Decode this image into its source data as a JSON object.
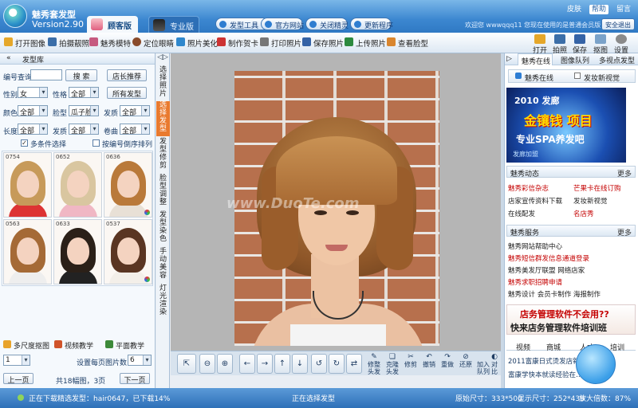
{
  "app": {
    "name": "魅秀套发型",
    "version": "Version2.90"
  },
  "mode_tabs": [
    "顾客版",
    "专业版"
  ],
  "top_buttons": [
    "发型工具",
    "官方网站",
    "关闭精灵",
    "更新程序"
  ],
  "window_links": [
    "皮肤",
    "帮助",
    "留言"
  ],
  "welcome_text": "欢迎您 wwwqqq11 您现在使用的是普通会员版",
  "exit_label": "安全退出",
  "toolbar": [
    "打开图像",
    "拍摄靓照",
    "魅秀模特",
    "定位眼睛",
    "照片美化",
    "制作贺卡",
    "打印照片",
    "保存照片",
    "上传照片",
    "查看脸型"
  ],
  "toolbar_right": [
    "打开",
    "拍照",
    "保存",
    "抠图",
    "设置"
  ],
  "left": {
    "title": "发型库",
    "code_label": "编号查询",
    "search_btn": "搜 索",
    "recommend_btn": "店长推荐",
    "all_btn": "所有发型",
    "filters": [
      {
        "label": "性别",
        "value": "女"
      },
      {
        "label": "性格",
        "value": "全部"
      },
      {
        "label": "颜色",
        "value": "全部"
      },
      {
        "label": "脸型",
        "value": "瓜子脸"
      },
      {
        "label": "发质",
        "value": "全部"
      },
      {
        "label": "长度",
        "value": "全部"
      },
      {
        "label": "发质",
        "value": "全部"
      },
      {
        "label": "卷曲",
        "value": "全部"
      }
    ],
    "multi_select": "多条件选择",
    "sort_desc": "按编号倒序排列",
    "thumbs": [
      "0754",
      "0652",
      "0636",
      "0563",
      "0633",
      "0537"
    ],
    "teach": [
      "多尺度抠图",
      "视频教学",
      "平面教学"
    ],
    "page_value": "1",
    "per_page_label": "设置每页图片数",
    "per_page_value": "6",
    "prev": "上一页",
    "next": "下一页",
    "total": "共18幅图，3页"
  },
  "vnav": [
    "选择照片",
    "选择发型",
    "发型修剪",
    "脸型调整",
    "发型染色",
    "手动美容",
    "灯光渲染"
  ],
  "watermark": "www.DuoTe.com",
  "ctrl": [
    "修整头发",
    "克隆头发",
    "修剪",
    "撤销",
    "重做",
    "还原",
    "加入队列",
    "对比"
  ],
  "right": {
    "tabs": [
      "魅秀在线",
      "图像队列",
      "多视点发型"
    ],
    "subtabs": [
      "魅秀在线",
      "发妆新视觉"
    ],
    "banner": {
      "t1": "2010 发廊",
      "t2": "金镶钱 项目",
      "t3": "专业SPA养发吧",
      "t4": "发廊加盟"
    },
    "dyn_title": "魅秀动态",
    "more": "更多",
    "dyn_items": [
      [
        "魅秀彩信杂志",
        "芒果卡在线订购"
      ],
      [
        "店家宣传资料下载",
        "发妆新视觉"
      ],
      [
        "在线配发",
        "名店秀"
      ]
    ],
    "svc_title": "魅秀服务",
    "svc_items": [
      "魅秀网站帮助中心",
      "魅秀短信群发信息通道登录",
      "魅秀美发厅联盟  网络店家",
      "魅秀求职招聘申请",
      "魅秀设计  会员卡制作  海报制作"
    ],
    "ad": {
      "a": "店务管理软件不会用??",
      "b": "快来店务管理软件培训班"
    },
    "bottom_tabs": [
      "视频",
      "商城",
      "人才",
      "培训"
    ],
    "links": [
      "2011富康日式烫发店新…",
      "富康学快本就读经验在…"
    ]
  },
  "status": {
    "downloading": "正在下载精选发型：hair0647，已下载14%",
    "selecting": "正在选择发型",
    "orig": "原始尺寸：333*500",
    "display": "显示尺寸：252*439",
    "zoom": "放大倍数：87%"
  }
}
